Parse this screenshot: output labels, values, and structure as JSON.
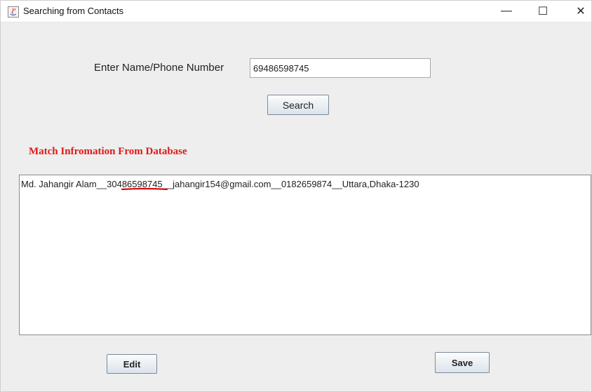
{
  "window": {
    "title": "Searching from Contacts",
    "controls": {
      "minimize": "—",
      "maximize": "☐",
      "close": "✕"
    }
  },
  "search": {
    "label": "Enter Name/Phone Number",
    "value": "69486598745",
    "button_label": "Search"
  },
  "results": {
    "heading": "Match Infromation From Database",
    "text": "Md. Jahangir Alam__30486598745__jahangir154@gmail.com__0182659874__Uttara,Dhaka-1230"
  },
  "actions": {
    "edit_label": "Edit",
    "save_label": "Save"
  },
  "colors": {
    "heading": "#e01818",
    "annotation": "#d01010"
  }
}
